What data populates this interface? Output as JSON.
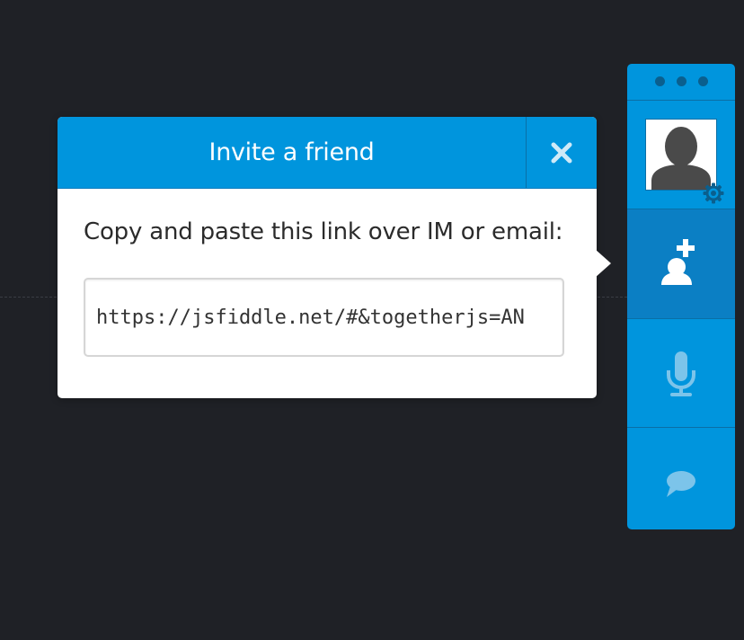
{
  "modal": {
    "title": "Invite a friend",
    "close_icon": "close-icon",
    "instructions": "Copy and paste this link over IM or email:",
    "link_value": "https://jsfiddle.net/#&togetherjs=AN"
  },
  "dock": {
    "handle_icon": "drag-dots-icon",
    "profile": {
      "avatar_icon": "default-avatar-icon",
      "settings_icon": "gear-icon"
    },
    "buttons": [
      {
        "name": "invite",
        "icon": "add-user-icon",
        "active": true
      },
      {
        "name": "audio",
        "icon": "microphone-icon",
        "active": false
      },
      {
        "name": "chat",
        "icon": "chat-bubble-icon",
        "active": false
      }
    ]
  },
  "colors": {
    "background": "#1f2126",
    "accent": "#0095dd",
    "accent_active": "#0b7fc4",
    "dock_divider": "#0a6fa6"
  }
}
